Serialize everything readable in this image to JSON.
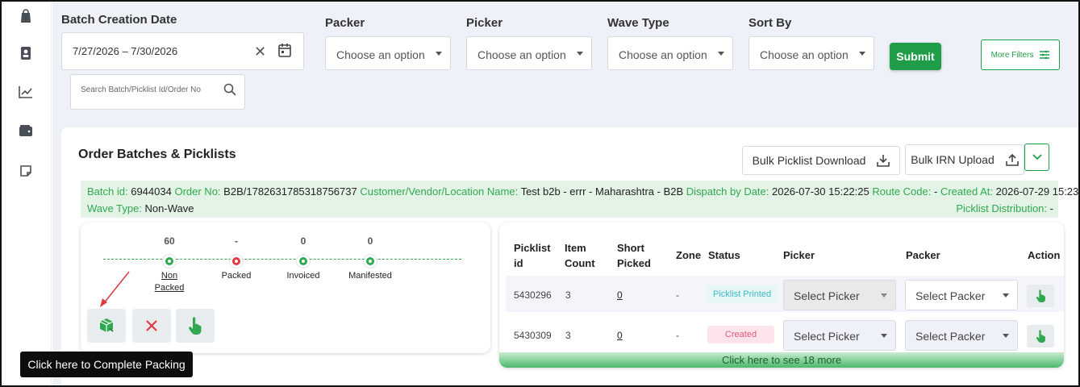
{
  "filters": {
    "batch_date_label": "Batch Creation Date",
    "date_range": "7/27/2026 – 7/30/2026",
    "packer_label": "Packer",
    "picker_label": "Picker",
    "wave_type_label": "Wave Type",
    "sort_by_label": "Sort By",
    "packer_value": "Choose an option",
    "picker_value": "Choose an option",
    "wave_value": "Choose an option",
    "sort_value": "Choose an option",
    "submit_label": "Submit",
    "more_filters_label": "More Filters",
    "search_placeholder": "Search Batch/Picklist Id/Order No"
  },
  "card": {
    "title": "Order Batches & Picklists",
    "bulk_picklist_download": "Bulk Picklist Download",
    "bulk_irn_upload": "Bulk IRN Upload"
  },
  "batch": {
    "batch_id_key": "Batch id:",
    "batch_id": "6944034",
    "order_no_key": "Order No:",
    "order_no": "B2B/1782631785318756737",
    "customer_key": "Customer/Vendor/Location Name:",
    "customer": "Test b2b - errr - Maharashtra - B2B",
    "dispatch_key": "Dispatch by Date:",
    "dispatch": "2026-07-30 15:22:25",
    "route_key": "Route Code:",
    "route": "-",
    "created_key": "Created At:",
    "created": "2026-07-29 15:23:11",
    "wave_key": "Wave Type:",
    "wave": "Non-Wave",
    "distribution_key": "Picklist Distribution:",
    "distribution": "-"
  },
  "stages": [
    {
      "count": "60",
      "name_line1": "Non",
      "name_line2": "Packed",
      "color": "#2fa84f"
    },
    {
      "count": "-",
      "name_line1": "Packed",
      "name_line2": "",
      "color": "#e0393e"
    },
    {
      "count": "0",
      "name_line1": "Invoiced",
      "name_line2": "",
      "color": "#2fa84f"
    },
    {
      "count": "0",
      "name_line1": "Manifested",
      "name_line2": "",
      "color": "#2fa84f"
    }
  ],
  "table": {
    "headers": {
      "picklist_id_1": "Picklist",
      "picklist_id_2": "id",
      "item_count_1": "Item",
      "item_count_2": "Count",
      "short_picked_1": "Short",
      "short_picked_2": "Picked",
      "zone": "Zone",
      "status": "Status",
      "picker": "Picker",
      "packer": "Packer",
      "action": "Action"
    },
    "rows": [
      {
        "id": "5430296",
        "count": "3",
        "short": "0",
        "zone": "-",
        "status": "Picklist Printed",
        "picker": "Select Picker",
        "packer": "Select Packer"
      },
      {
        "id": "5430309",
        "count": "3",
        "short": "0",
        "zone": "-",
        "status": "Created",
        "picker": "Select Picker",
        "packer": "Select Packer"
      }
    ],
    "see_more": "Click here to see 18 more"
  },
  "tooltip": "Click here to Complete Packing",
  "colors": {
    "accent": "#1f9d48",
    "status_printed_bg": "#e6f7f8",
    "status_printed_fg": "#3fb9c4",
    "status_created_bg": "#fde4ea",
    "status_created_fg": "#e0597d"
  }
}
